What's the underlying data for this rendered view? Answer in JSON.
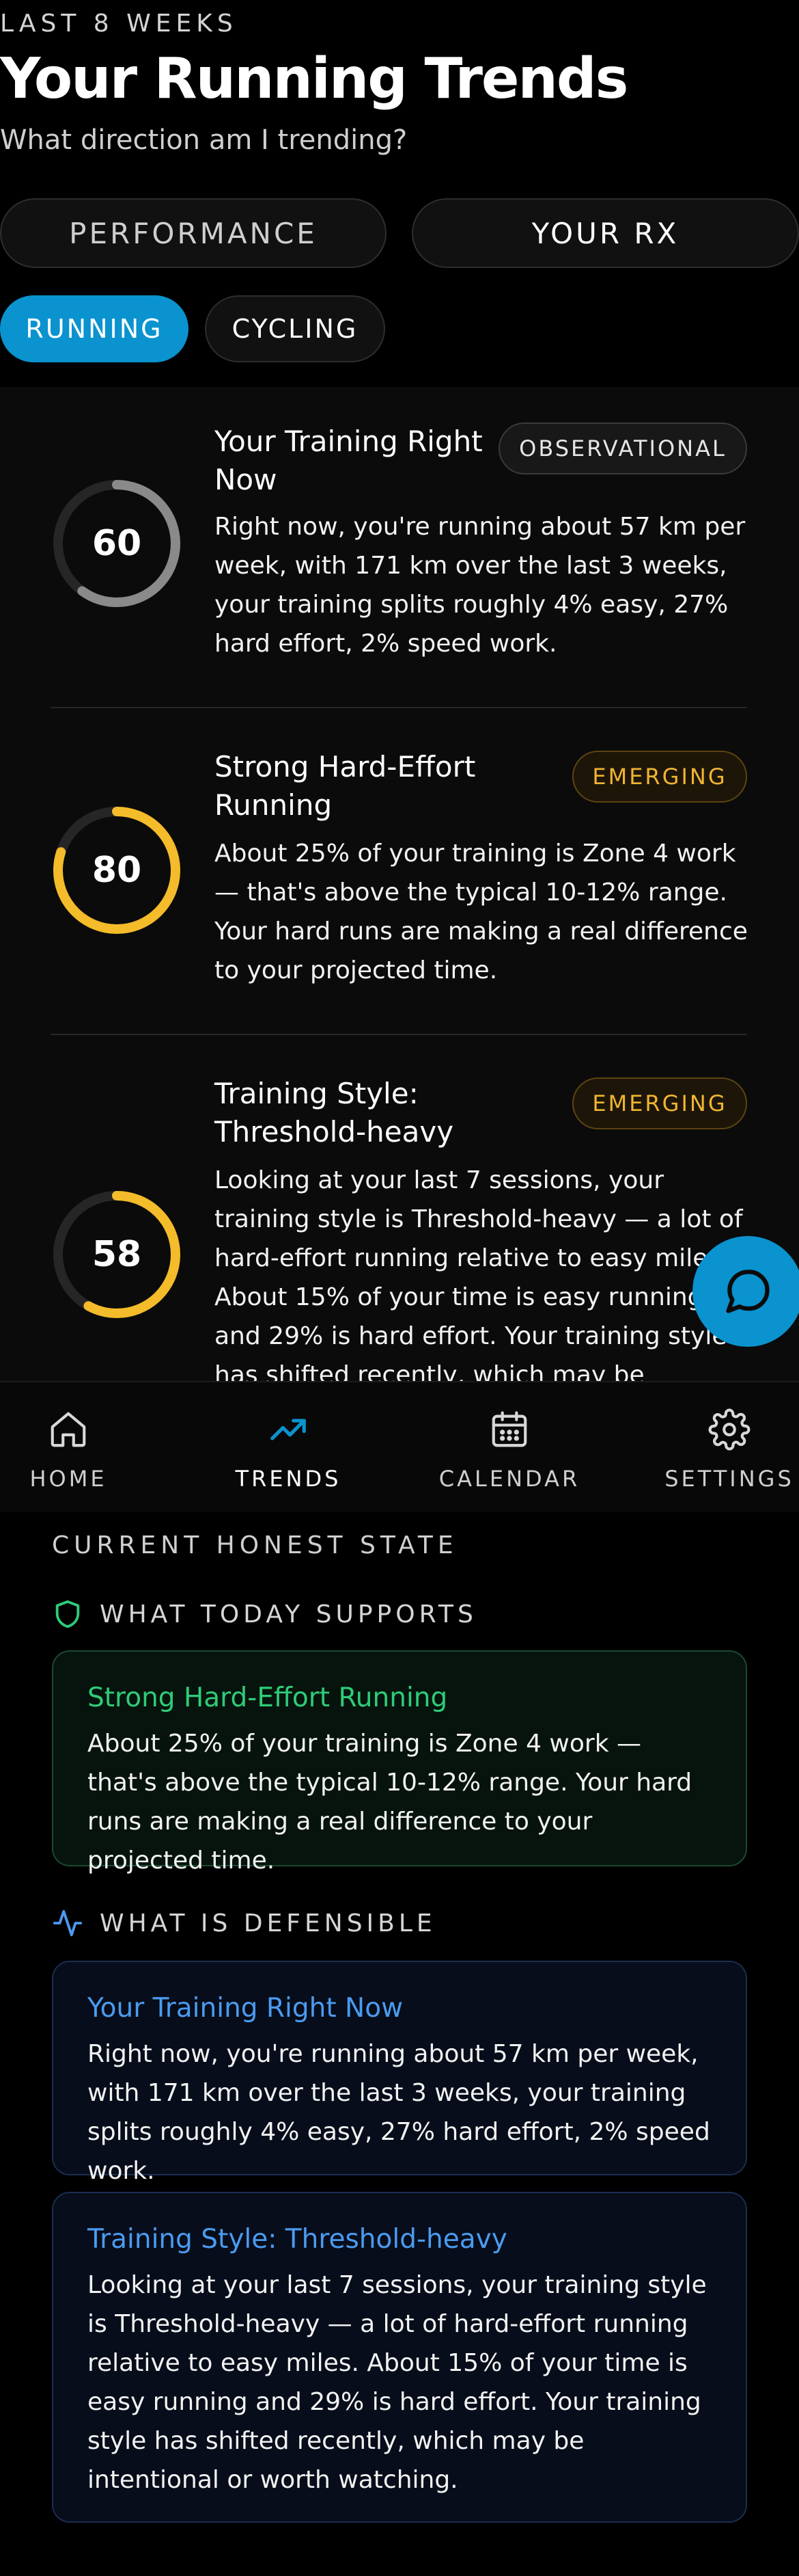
{
  "header": {
    "eyebrow": "LAST 8 WEEKS",
    "title": "Your Running Trends",
    "subtitle": "What direction am I trending?"
  },
  "segments": {
    "performance": "PERFORMANCE",
    "your_rx": "YOUR RX"
  },
  "sport_chips": {
    "running": "RUNNING",
    "cycling": "CYCLING",
    "selected": "running"
  },
  "trend_cards": [
    {
      "score": "60",
      "score_fraction": 0.6,
      "ring_color": "#8a8a8a",
      "title": "Your Training Right Now",
      "badge": "OBSERVATIONAL",
      "body": "Right now, you're running about 57 km per week, with 171 km over the last 3 weeks, your training splits roughly 4% easy, 27% hard effort, 2% speed work."
    },
    {
      "score": "80",
      "score_fraction": 0.8,
      "ring_color": "#f4bb2a",
      "title": "Strong Hard-Effort Running",
      "badge": "EMERGING",
      "body": "About 25% of your training is Zone 4 work — that's above the typical 10-12% range. Your hard runs are making a real difference to your projected time."
    },
    {
      "score": "58",
      "score_fraction": 0.58,
      "ring_color": "#f4bb2a",
      "title": "Training Style: Threshold-heavy",
      "badge": "EMERGING",
      "body": "Looking at your last 7 sessions, your training style is Threshold-heavy — a lot of hard-effort running relative to easy miles. About 15% of your time is easy running and 29% is hard effort. Your training style has shifted recently, which may be intentional or worth watching."
    }
  ],
  "nav": {
    "home": "HOME",
    "trends": "TRENDS",
    "calendar": "CALENDAR",
    "settings": "SETTINGS",
    "active": "trends"
  },
  "honest_state": {
    "label": "CURRENT HONEST STATE",
    "supports": {
      "label": "WHAT TODAY SUPPORTS",
      "cards": [
        {
          "title": "Strong Hard-Effort Running",
          "body": "About 25% of your training is Zone 4 work — that's above the typical 10-12% range. Your hard runs are making a real difference to your projected time."
        }
      ]
    },
    "defensible": {
      "label": "WHAT IS DEFENSIBLE",
      "cards": [
        {
          "title": "Your Training Right Now",
          "body": "Right now, you're running about 57 km per week, with 171 km over the last 3 weeks, your training splits roughly 4% easy, 27% hard effort, 2% speed work."
        },
        {
          "title": "Training Style: Threshold-heavy",
          "body": "Looking at your last 7 sessions, your training style is Threshold-heavy — a lot of hard-effort running relative to easy miles. About 15% of your time is easy running and 29% is hard effort. Your training style has shifted recently, which may be intentional or worth watching."
        }
      ]
    }
  },
  "colors": {
    "accent": "#0a93cf",
    "emerging": "#f0b432",
    "supports_green": "#2ecc78",
    "defensible_blue": "#4a9bf0"
  },
  "icons": {
    "chat": "chat-bubble-icon",
    "home": "home-icon",
    "trends": "trending-up-icon",
    "calendar": "calendar-icon",
    "settings": "gear-icon",
    "supports": "shield-icon",
    "defensible": "activity-pulse-icon"
  }
}
